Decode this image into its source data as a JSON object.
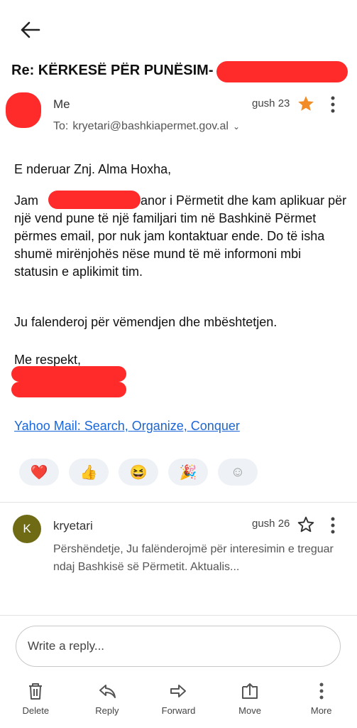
{
  "header": {
    "back_icon": "arrow-left-icon"
  },
  "subject": "Re: KËRKESË PËR PUNËSIM-",
  "message1": {
    "sender": "Me",
    "date": "gush 23",
    "starred": true,
    "to_label": "To:",
    "to_address": "kryetari@bashkiapermet.gov.al",
    "greeting": "E nderuar Znj. Alma Hoxha,",
    "para1_start": "Jam",
    "para1_rest": ", banor i Përmetit dhe kam aplikuar për një vend pune të një familjari tim në Bashkinë Përmet përmes email, por nuk jam kontaktuar ende. Do të isha shumë mirënjohës nëse mund të më informoni mbi statusin e aplikimit tim.",
    "para2": "Ju falenderoj për vëmendjen dhe mbështetjen.",
    "closing": "Me respekt,",
    "signature_link": "Yahoo Mail: Search, Organize, Conquer"
  },
  "reactions": [
    {
      "name": "heart",
      "glyph": "❤️"
    },
    {
      "name": "thumbs-up",
      "glyph": "👍"
    },
    {
      "name": "laughing",
      "glyph": "😆"
    },
    {
      "name": "party-popper",
      "glyph": "🎉"
    },
    {
      "name": "add-reaction",
      "glyph": "☺"
    }
  ],
  "message2": {
    "avatar_letter": "K",
    "sender": "kryetari",
    "date": "gush 26",
    "starred": false,
    "snippet": "Përshëndetje, Ju falënderojmë për interesimin e treguar ndaj Bashkisë së Përmetit. Aktualis..."
  },
  "reply_placeholder": "Write a reply...",
  "toolbar": {
    "delete": "Delete",
    "reply": "Reply",
    "forward": "Forward",
    "move": "Move",
    "more": "More"
  },
  "colors": {
    "accent_link": "#1a66d9",
    "star_filled": "#f28c28",
    "avatar_k": "#6f6a14",
    "redaction": "#ff2b2b"
  }
}
